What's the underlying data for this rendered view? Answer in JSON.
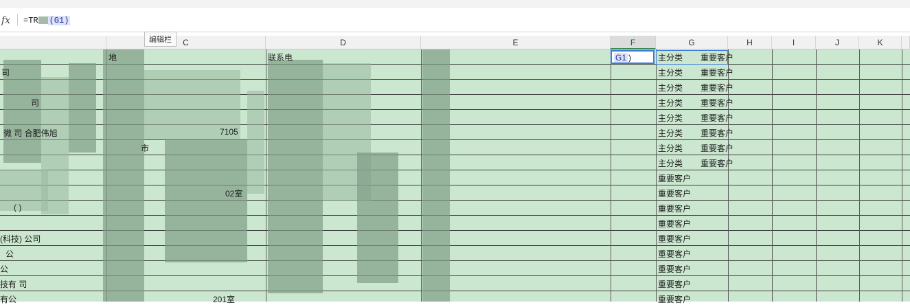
{
  "formula_bar": {
    "fx_label": "fx",
    "formula_prefix": "=TR",
    "formula_ref": "(G1)"
  },
  "tooltip": {
    "text": "编辑栏"
  },
  "columns": [
    "C",
    "D",
    "E",
    "F",
    "G",
    "H",
    "I",
    "J",
    "K"
  ],
  "active_cell": {
    "column": "F",
    "value_ref": "G1",
    "value_suffix": ")"
  },
  "header_row": {
    "c_visible": "地",
    "d_visible": "联系电"
  },
  "left_visible_text": {
    "row1": "司",
    "row4": "司",
    "row6": "微   司   合肥伟旭",
    "row11": "(     )",
    "row13": "(科技)    公司",
    "row14": "公",
    "row15": "公",
    "row16": "技有    司",
    "row17": "有公"
  },
  "middle_visible_text": {
    "row6_c": "7105",
    "row7_c": "市",
    "row10_c": "02室",
    "row17_c": "201室"
  },
  "g_column": {
    "rows_with_main": [
      "主分类",
      "主分类",
      "主分类",
      "主分类",
      "主分类",
      "主分类",
      "主分类",
      "主分类"
    ],
    "values": [
      "重要客户",
      "重要客户",
      "重要客户",
      "重要客户",
      "重要客户",
      "重要客户",
      "重要客户",
      "重要客户",
      "重要客户",
      "重要客户",
      "重要客户",
      "重要客户",
      "重要客户",
      "重要客户",
      "重要客户",
      "重要客户",
      "重要客户"
    ]
  }
}
